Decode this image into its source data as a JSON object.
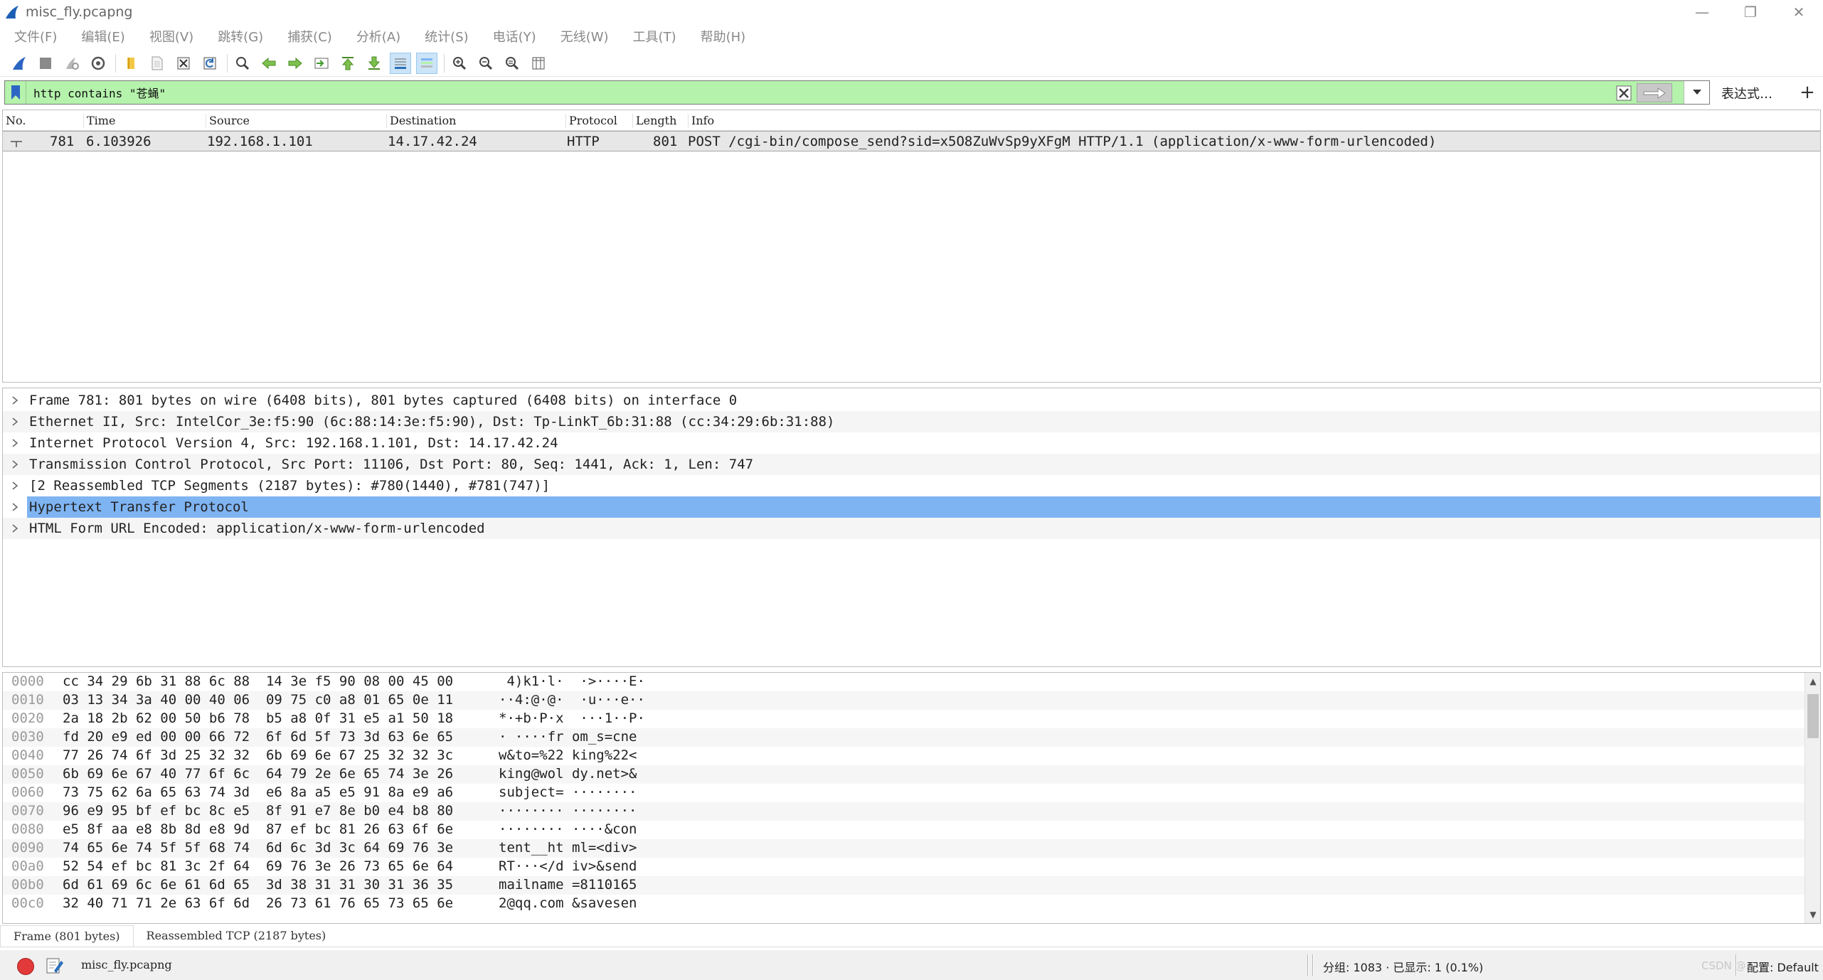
{
  "window": {
    "title": "misc_fly.pcapng",
    "minimize": "—",
    "restore": "❐",
    "close": "✕"
  },
  "menu": [
    "文件(F)",
    "编辑(E)",
    "视图(V)",
    "跳转(G)",
    "捕获(C)",
    "分析(A)",
    "统计(S)",
    "电话(Y)",
    "无线(W)",
    "工具(T)",
    "帮助(H)"
  ],
  "filter": {
    "value": "http contains \"苍蝇\"",
    "expression_label": "表达式…",
    "add_label": "+"
  },
  "packet_list": {
    "columns": [
      "No.",
      "Time",
      "Source",
      "Destination",
      "Protocol",
      "Length",
      "Info"
    ],
    "rows": [
      {
        "no": "781",
        "time": "6.103926",
        "source": "192.168.1.101",
        "destination": "14.17.42.24",
        "protocol": "HTTP",
        "length": "801",
        "info": "POST /cgi-bin/compose_send?sid=x5O8ZuWvSp9yXFgM HTTP/1.1  (application/x-www-form-urlencoded)"
      }
    ]
  },
  "details": {
    "rows": [
      "Frame 781: 801 bytes on wire (6408 bits), 801 bytes captured (6408 bits) on interface 0",
      "Ethernet II, Src: IntelCor_3e:f5:90 (6c:88:14:3e:f5:90), Dst: Tp-LinkT_6b:31:88 (cc:34:29:6b:31:88)",
      "Internet Protocol Version 4, Src: 192.168.1.101, Dst: 14.17.42.24",
      "Transmission Control Protocol, Src Port: 11106, Dst Port: 80, Seq: 1441, Ack: 1, Len: 747",
      "[2 Reassembled TCP Segments (2187 bytes): #780(1440), #781(747)]",
      "Hypertext Transfer Protocol",
      "HTML Form URL Encoded: application/x-www-form-urlencoded"
    ],
    "selected_index": 5
  },
  "bytes": {
    "rows": [
      {
        "offset": "0000",
        "hex": "cc 34 29 6b 31 88 6c 88  14 3e f5 90 08 00 45 00",
        "ascii": " 4)k1·l·  ·>····E·"
      },
      {
        "offset": "0010",
        "hex": "03 13 34 3a 40 00 40 06  09 75 c0 a8 01 65 0e 11",
        "ascii": "··4:@·@·  ·u···e··"
      },
      {
        "offset": "0020",
        "hex": "2a 18 2b 62 00 50 b6 78  b5 a8 0f 31 e5 a1 50 18",
        "ascii": "*·+b·P·x  ···1··P·"
      },
      {
        "offset": "0030",
        "hex": "fd 20 e9 ed 00 00 66 72  6f 6d 5f 73 3d 63 6e 65",
        "ascii": "· ····fr om_s=cne"
      },
      {
        "offset": "0040",
        "hex": "77 26 74 6f 3d 25 32 32  6b 69 6e 67 25 32 32 3c",
        "ascii": "w&to=%22 king%22<"
      },
      {
        "offset": "0050",
        "hex": "6b 69 6e 67 40 77 6f 6c  64 79 2e 6e 65 74 3e 26",
        "ascii": "king@wol dy.net>&"
      },
      {
        "offset": "0060",
        "hex": "73 75 62 6a 65 63 74 3d  e6 8a a5 e5 91 8a e9 a6",
        "ascii": "subject= ········"
      },
      {
        "offset": "0070",
        "hex": "96 e9 95 bf ef bc 8c e5  8f 91 e7 8e b0 e4 b8 80",
        "ascii": "········ ········"
      },
      {
        "offset": "0080",
        "hex": "e5 8f aa e8 8b 8d e8 9d  87 ef bc 81 26 63 6f 6e",
        "ascii": "········ ····&con"
      },
      {
        "offset": "0090",
        "hex": "74 65 6e 74 5f 5f 68 74  6d 6c 3d 3c 64 69 76 3e",
        "ascii": "tent__ht ml=<div>"
      },
      {
        "offset": "00a0",
        "hex": "52 54 ef bc 81 3c 2f 64  69 76 3e 26 73 65 6e 64",
        "ascii": "RT···</d iv>&send"
      },
      {
        "offset": "00b0",
        "hex": "6d 61 69 6c 6e 61 6d 65  3d 38 31 31 30 31 36 35",
        "ascii": "mailname =8110165"
      },
      {
        "offset": "00c0",
        "hex": "32 40 71 71 2e 63 6f 6d  26 73 61 76 65 73 65 6e",
        "ascii": "2@qq.com &savesen"
      }
    ]
  },
  "byte_tabs": [
    "Frame (801 bytes)",
    "Reassembled TCP (2187 bytes)"
  ],
  "status": {
    "file": "misc_fly.pcapng",
    "packets": "分组: 1083 · 已显示: 1 (0.1%)",
    "profile": "配置: Default",
    "watermark": "CSDN @..."
  },
  "colors": {
    "filter_valid_bg": "#b5f2ac",
    "selected_detail_bg": "#7fb4f3",
    "expert_error": "#e23a3a"
  }
}
